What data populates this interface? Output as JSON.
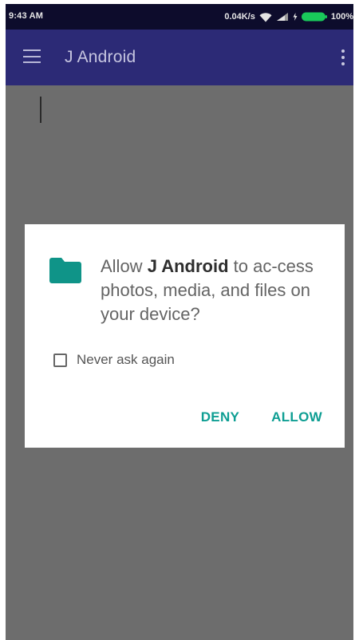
{
  "status_bar": {
    "time": "9:43 AM",
    "net_speed": "0.04K/s",
    "battery_percent": "100%",
    "icons": [
      "wifi-icon",
      "signal-icon",
      "battery-icon"
    ]
  },
  "app_bar": {
    "title": "J Android",
    "background_color": "#2c2a76",
    "icons": [
      "hamburger-menu-icon",
      "overflow-menu-icon"
    ]
  },
  "permission_dialog": {
    "icon": "folder-icon",
    "icon_color": "#0f9488",
    "message_prefix": "Allow ",
    "app_name": "J Android",
    "message_suffix": " to ac-cess photos, media, and files on your device?",
    "never_ask_checkbox": {
      "label": "Never ask again",
      "checked": false
    },
    "buttons": {
      "deny": "DENY",
      "allow": "ALLOW"
    },
    "button_color": "#0e9e93"
  },
  "colors": {
    "scrim": "#6d6d6d",
    "status_bar": "#0d0c2c"
  }
}
